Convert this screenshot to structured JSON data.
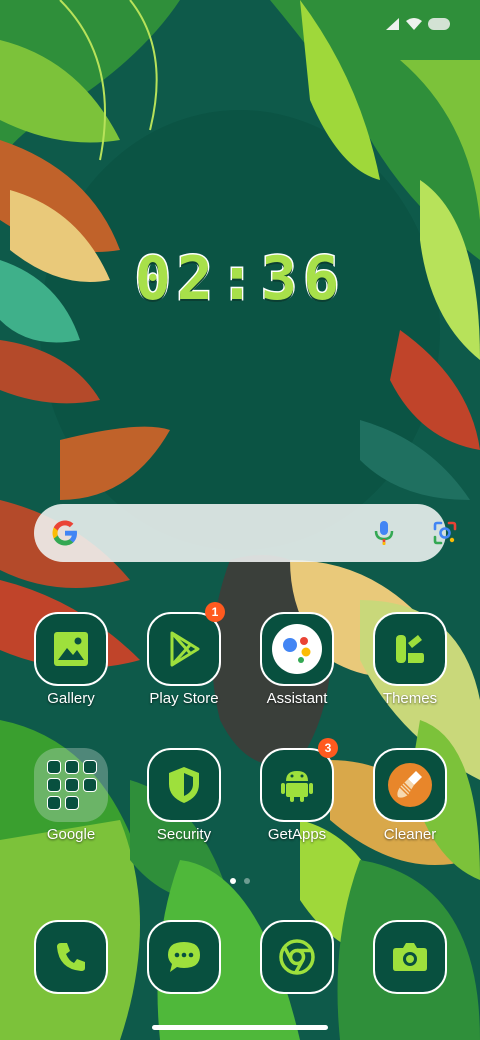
{
  "status_bar": {
    "icons": [
      "signal-icon",
      "wifi-icon",
      "battery-icon"
    ]
  },
  "clock": {
    "time": "02:36"
  },
  "search": {
    "icons": [
      "google-g-icon",
      "microphone-icon",
      "google-lens-icon"
    ]
  },
  "apps": {
    "row1": [
      {
        "label": "Gallery",
        "icon": "gallery-icon"
      },
      {
        "label": "Play Store",
        "icon": "play-store-icon",
        "badge": "1"
      },
      {
        "label": "Assistant",
        "icon": "assistant-icon"
      },
      {
        "label": "Themes",
        "icon": "themes-icon"
      }
    ],
    "row2": [
      {
        "label": "Google",
        "icon": "google-folder-icon"
      },
      {
        "label": "Security",
        "icon": "security-shield-icon"
      },
      {
        "label": "GetApps",
        "icon": "android-icon",
        "badge": "3"
      },
      {
        "label": "Cleaner",
        "icon": "broom-icon"
      }
    ]
  },
  "dock": {
    "items": [
      {
        "icon": "phone-icon"
      },
      {
        "icon": "messages-icon"
      },
      {
        "icon": "chrome-icon"
      },
      {
        "icon": "camera-icon"
      }
    ]
  },
  "colors": {
    "background": "#0e5a4a",
    "icon_tile": "#08503f",
    "icon_glyph": "#9ee03c",
    "clock_fill": "#a8e04a",
    "badge": "#ff5a1f",
    "cleaner_accent": "#e8862a"
  }
}
